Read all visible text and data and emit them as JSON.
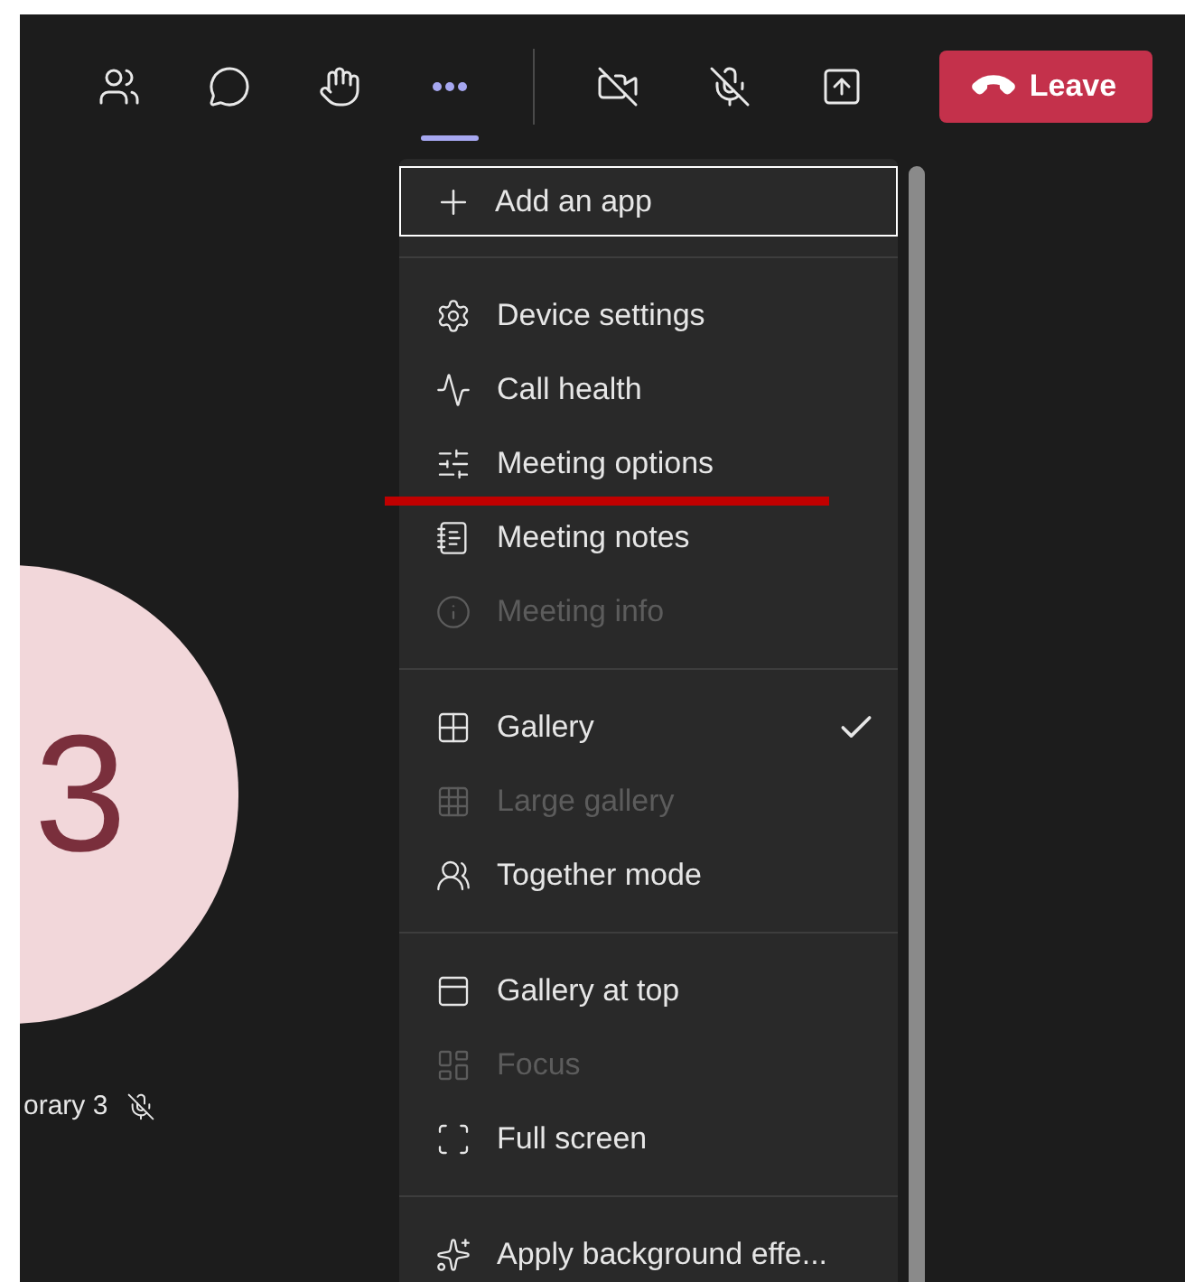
{
  "toolbar": {
    "buttons": [
      {
        "kind": "people",
        "selected": false
      },
      {
        "kind": "chat",
        "selected": false
      },
      {
        "kind": "react",
        "selected": false
      },
      {
        "kind": "more",
        "selected": true
      },
      {
        "kind": "camera",
        "selected": false
      },
      {
        "kind": "mic",
        "selected": false
      },
      {
        "kind": "share",
        "selected": false
      }
    ],
    "leave": {
      "label": "Leave"
    }
  },
  "stage": {
    "avatar": {
      "initial": "3"
    },
    "participant": {
      "name": "orary 3",
      "muted": true
    }
  },
  "menu": {
    "add_app": {
      "label": "Add an app",
      "focused": true
    },
    "sections": [
      [
        {
          "label": "Device settings",
          "disabled": false,
          "selected": false
        },
        {
          "label": "Call health",
          "disabled": false,
          "selected": false
        },
        {
          "label": "Meeting options",
          "disabled": false,
          "selected": false,
          "underlined": true
        },
        {
          "label": "Meeting notes",
          "disabled": false,
          "selected": false
        },
        {
          "label": "Meeting info",
          "disabled": true,
          "selected": false
        }
      ],
      [
        {
          "label": "Gallery",
          "disabled": false,
          "selected": true
        },
        {
          "label": "Large gallery",
          "disabled": true,
          "selected": false
        },
        {
          "label": "Together mode",
          "disabled": false,
          "selected": false
        }
      ],
      [
        {
          "label": "Gallery at top",
          "disabled": false,
          "selected": false
        },
        {
          "label": "Focus",
          "disabled": true,
          "selected": false
        },
        {
          "label": "Full screen",
          "disabled": false,
          "selected": false
        }
      ],
      [
        {
          "label": "Apply background effe...",
          "disabled": false,
          "selected": false
        }
      ]
    ]
  }
}
